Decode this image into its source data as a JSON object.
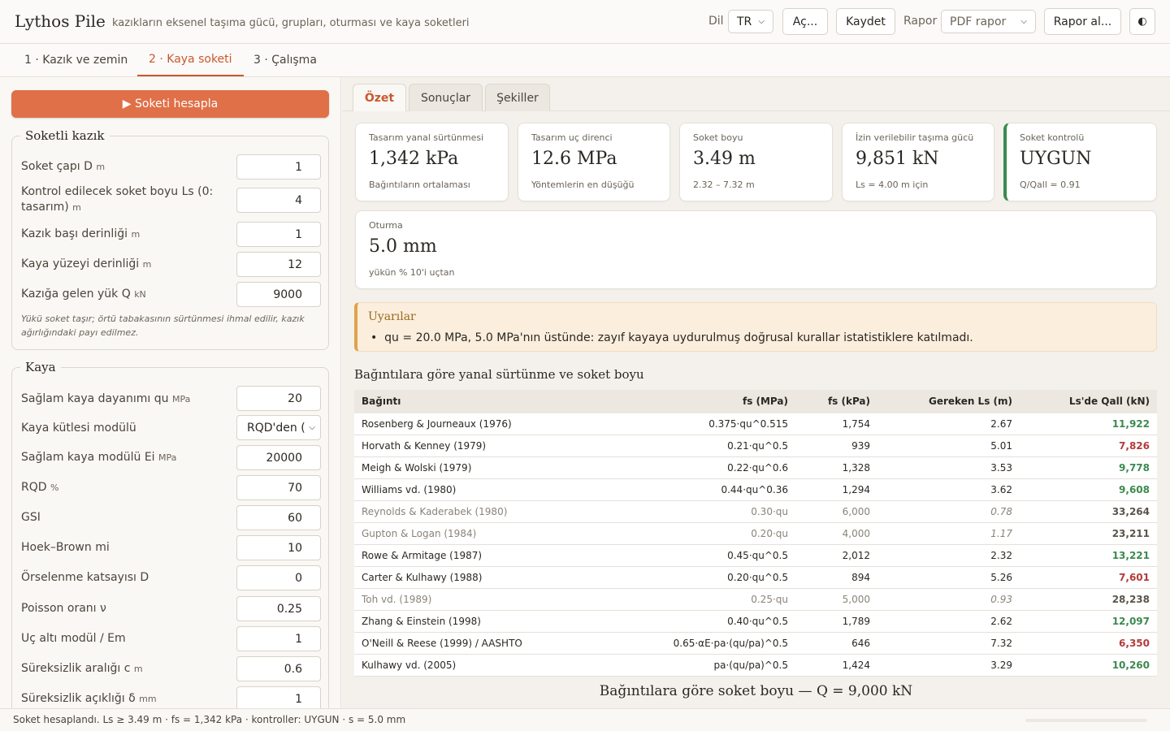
{
  "header": {
    "title": "Lythos Pile",
    "subtitle": "kazıkların eksenel taşıma gücü, grupları, oturması ve kaya soketleri",
    "lang_label": "Dil",
    "lang_value": "TR",
    "open_label": "Aç...",
    "save_label": "Kaydet",
    "report_label": "Rapor",
    "report_value": "PDF rapor",
    "report_btn": "Rapor al...",
    "theme_icon": "◐"
  },
  "steps": [
    {
      "label": "1 · Kazık ve zemin"
    },
    {
      "label": "2 · Kaya soketi"
    },
    {
      "label": "3 · Çalışma"
    }
  ],
  "left": {
    "run_label": "▶ Soketi hesapla",
    "pile": {
      "legend": "Soketli kazık",
      "fields": [
        {
          "label": "Soket çapı D",
          "unit": "m",
          "value": "1"
        },
        {
          "label": "Kontrol edilecek soket boyu Ls (0:",
          "label2": "tasarım)",
          "unit": "m",
          "value": "4"
        },
        {
          "label": "Kazık başı derinliği",
          "unit": "m",
          "value": "1"
        },
        {
          "label": "Kaya yüzeyi derinliği",
          "unit": "m",
          "value": "12"
        },
        {
          "label": "Kazığa gelen yük Q",
          "unit": "kN",
          "value": "9000"
        }
      ],
      "note": "Yükü soket taşır; örtü tabakasının sürtünmesi ihmal edilir, kazık ağırlığındaki payı edilmez."
    },
    "rock": {
      "legend": "Kaya",
      "fields": [
        {
          "label": "Sağlam kaya dayanımı qu",
          "unit": "MPa",
          "value": "20"
        },
        {
          "label": "Kaya kütlesi modülü",
          "unit": "",
          "value": "RQD'den ("
        },
        {
          "label": "Sağlam kaya modülü Ei",
          "unit": "MPa",
          "value": "20000"
        },
        {
          "label": "RQD",
          "unit": "%",
          "value": "70"
        },
        {
          "label": "GSI",
          "unit": "",
          "value": "60"
        },
        {
          "label": "Hoek–Brown mi",
          "unit": "",
          "value": "10"
        },
        {
          "label": "Örselenme katsayısı D",
          "unit": "",
          "value": "0"
        },
        {
          "label": "Poisson oranı ν",
          "unit": "",
          "value": "0.25"
        },
        {
          "label": "Uç altı modül / Em",
          "unit": "",
          "value": "1"
        },
        {
          "label": "Süreksizlik aralığı c",
          "unit": "m",
          "value": "0.6"
        },
        {
          "label": "Süreksizlik açıklığı δ",
          "unit": "mm",
          "value": "1"
        }
      ]
    }
  },
  "right": {
    "tabs": [
      {
        "label": "Özet"
      },
      {
        "label": "Sonuçlar"
      },
      {
        "label": "Şekiller"
      }
    ],
    "cards": [
      {
        "label": "Tasarım yanal sürtünmesi",
        "value": "1,342 kPa",
        "sub": "Bağıntıların ortalaması"
      },
      {
        "label": "Tasarım uç direnci",
        "value": "12.6 MPa",
        "sub": "Yöntemlerin en düşüğü"
      },
      {
        "label": "Soket boyu",
        "value": "3.49 m",
        "sub": "2.32 – 7.32 m"
      },
      {
        "label": "İzin verilebilir taşıma gücü",
        "value": "9,851 kN",
        "sub": "Ls = 4.00 m için"
      },
      {
        "label": "Soket kontrolü",
        "value": "UYGUN",
        "sub": "Q/Qall = 0.91"
      },
      {
        "label": "Oturma",
        "value": "5.0 mm",
        "sub": "yükün % 10'i uçtan"
      }
    ],
    "warning": {
      "title": "Uyarılar",
      "items": [
        "qu = 20.0 MPa, 5.0 MPa'nın üstünde: zayıf kayaya uydurulmuş doğrusal kurallar istatistiklere katılmadı."
      ]
    },
    "table": {
      "title": "Bağıntılara göre yanal sürtünme ve soket boyu",
      "headers": [
        "Bağıntı",
        "fs (MPa)",
        "fs (kPa)",
        "Gereken Ls (m)",
        "Ls'de Qall (kN)"
      ],
      "rows": [
        {
          "name": "Rosenberg & Journeaux (1976)",
          "fs": "0.375·qu^0.515",
          "fsk": "1,754",
          "ls": "2.67",
          "q": "11,922",
          "status": "ok"
        },
        {
          "name": "Horvath & Kenney (1979)",
          "fs": "0.21·qu^0.5",
          "fsk": "939",
          "ls": "5.01",
          "q": "7,826",
          "status": "fail"
        },
        {
          "name": "Meigh & Wolski (1979)",
          "fs": "0.22·qu^0.6",
          "fsk": "1,328",
          "ls": "3.53",
          "q": "9,778",
          "status": "ok"
        },
        {
          "name": "Williams vd. (1980)",
          "fs": "0.44·qu^0.36",
          "fsk": "1,294",
          "ls": "3.62",
          "q": "9,608",
          "status": "ok"
        },
        {
          "name": "Reynolds & Kaderabek (1980)",
          "fs": "0.30·qu",
          "fsk": "6,000",
          "ls": "0.78",
          "q": "33,264",
          "status": "excluded"
        },
        {
          "name": "Gupton & Logan (1984)",
          "fs": "0.20·qu",
          "fsk": "4,000",
          "ls": "1.17",
          "q": "23,211",
          "status": "excluded"
        },
        {
          "name": "Rowe & Armitage (1987)",
          "fs": "0.45·qu^0.5",
          "fsk": "2,012",
          "ls": "2.32",
          "q": "13,221",
          "status": "ok"
        },
        {
          "name": "Carter & Kulhawy (1988)",
          "fs": "0.20·qu^0.5",
          "fsk": "894",
          "ls": "5.26",
          "q": "7,601",
          "status": "fail"
        },
        {
          "name": "Toh vd. (1989)",
          "fs": "0.25·qu",
          "fsk": "5,000",
          "ls": "0.93",
          "q": "28,238",
          "status": "excluded"
        },
        {
          "name": "Zhang & Einstein (1998)",
          "fs": "0.40·qu^0.5",
          "fsk": "1,789",
          "ls": "2.62",
          "q": "12,097",
          "status": "ok"
        },
        {
          "name": "O'Neill & Reese (1999) / AASHTO",
          "fs": "0.65·αE·pa·(qu/pa)^0.5",
          "fsk": "646",
          "ls": "7.32",
          "q": "6,350",
          "status": "fail"
        },
        {
          "name": "Kulhawy vd. (2005)",
          "fs": "pa·(qu/pa)^0.5",
          "fsk": "1,424",
          "ls": "3.29",
          "q": "10,260",
          "status": "ok"
        }
      ]
    },
    "figure_title": "Bağıntılara göre soket boyu — Q = 9,000 kN"
  },
  "status": {
    "text": "Soket hesaplandı. Ls ≥ 3.49 m · fs = 1,342 kPa · kontroller: UYGUN · s = 5.0 mm"
  },
  "colors": {
    "accent": "#e07048",
    "ok": "#3c8a4f",
    "fail": "#b23b3b",
    "warn": "#e0a24a"
  }
}
